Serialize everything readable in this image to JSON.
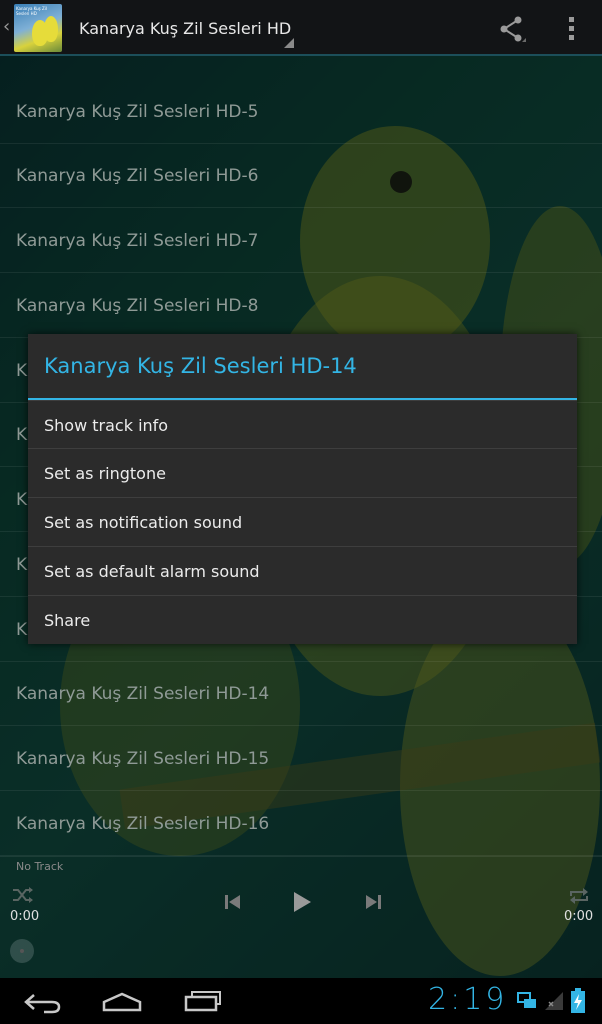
{
  "action_bar": {
    "title": "Kanarya Kuş Zil Sesleri HD",
    "icon_text": "Kanarya Kuş Zil Sesleri HD"
  },
  "tracks": [
    {
      "label": "Kanarya Kuş Zil Sesleri HD-5"
    },
    {
      "label": "Kanarya Kuş Zil Sesleri HD-6"
    },
    {
      "label": "Kanarya Kuş Zil Sesleri HD-7"
    },
    {
      "label": "Kanarya Kuş Zil Sesleri HD-8"
    },
    {
      "label": "K"
    },
    {
      "label": "K"
    },
    {
      "label": "K"
    },
    {
      "label": "K"
    },
    {
      "label": "K"
    },
    {
      "label": "Kanarya Kuş Zil Sesleri HD-14"
    },
    {
      "label": "Kanarya Kuş Zil Sesleri HD-15"
    },
    {
      "label": "Kanarya Kuş Zil Sesleri HD-16"
    }
  ],
  "context_menu": {
    "title": "Kanarya Kuş Zil Sesleri HD-14",
    "items": [
      {
        "label": "Show track info"
      },
      {
        "label": "Set as ringtone"
      },
      {
        "label": "Set as notification sound"
      },
      {
        "label": "Set as default alarm sound"
      },
      {
        "label": "Share"
      }
    ]
  },
  "player": {
    "track_status": "No Track",
    "elapsed": "0:00",
    "duration": "0:00",
    "progress": 0
  },
  "status_bar": {
    "clock": "2:19"
  },
  "colors": {
    "accent": "#33b5e5",
    "dialog_bg": "#2b2b2b",
    "action_bar_bg": "#121416"
  }
}
